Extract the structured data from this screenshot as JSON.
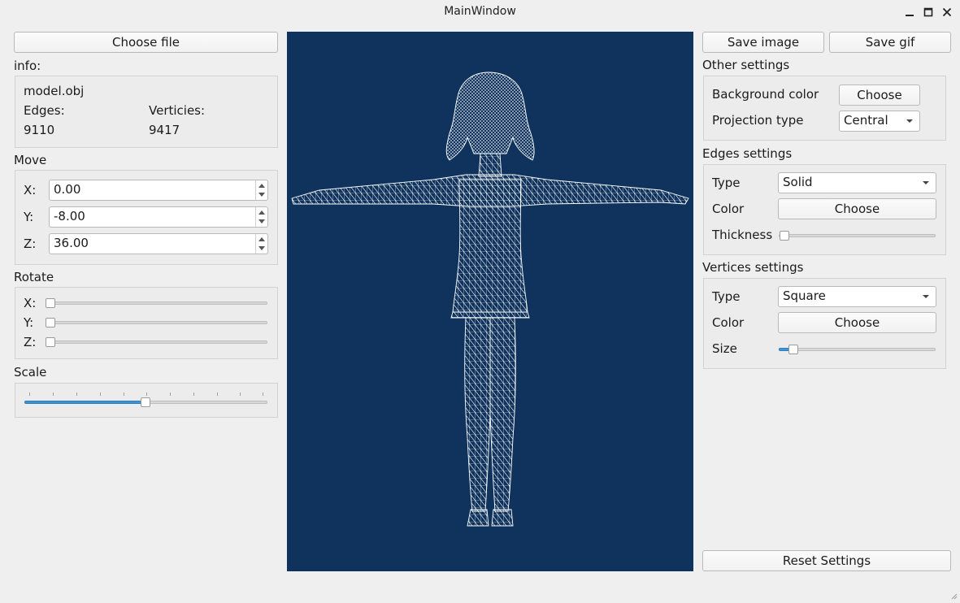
{
  "window": {
    "title": "MainWindow",
    "controls": {
      "minimize": "minimize-icon",
      "maximize": "maximize-icon",
      "close": "close-icon"
    }
  },
  "left": {
    "choose_file": "Choose file",
    "info_label": "info:",
    "file_name": "model.obj",
    "edges_label": "Edges:",
    "edges_value": "9110",
    "vertices_label": "Verticies:",
    "vertices_value": "9417",
    "move_title": "Move",
    "move": [
      {
        "label": "X:",
        "value": "0.00"
      },
      {
        "label": "Y:",
        "value": "-8.00"
      },
      {
        "label": "Z:",
        "value": "36.00"
      }
    ],
    "rotate_title": "Rotate",
    "rotate": [
      {
        "label": "X:",
        "level": 0
      },
      {
        "label": "Y:",
        "level": 0
      },
      {
        "label": "Z:",
        "level": 0
      }
    ],
    "scale_title": "Scale",
    "scale_level": 0.5
  },
  "viewport": {
    "background": "#0f335c",
    "wire_color": "#ffffff"
  },
  "right": {
    "save_image": "Save image",
    "save_gif": "Save gif",
    "other_title": "Other settings",
    "bg_color_label": "Background color",
    "bg_color_button": "Choose",
    "projection_label": "Projection type",
    "projection_value": "Central",
    "edges_title": "Edges settings",
    "edges_type_label": "Type",
    "edges_type_value": "Solid",
    "edges_color_label": "Color",
    "edges_color_button": "Choose",
    "edges_thickness_label": "Thickness",
    "edges_thickness_level": 0,
    "vertices_title": "Vertices settings",
    "vertices_type_label": "Type",
    "vertices_type_value": "Square",
    "vertices_color_label": "Color",
    "vertices_color_button": "Choose",
    "vertices_size_label": "Size",
    "vertices_size_level": 0.06,
    "reset": "Reset Settings"
  },
  "colors": {
    "accent": "#3d95d8",
    "window_bg": "#efefef"
  }
}
